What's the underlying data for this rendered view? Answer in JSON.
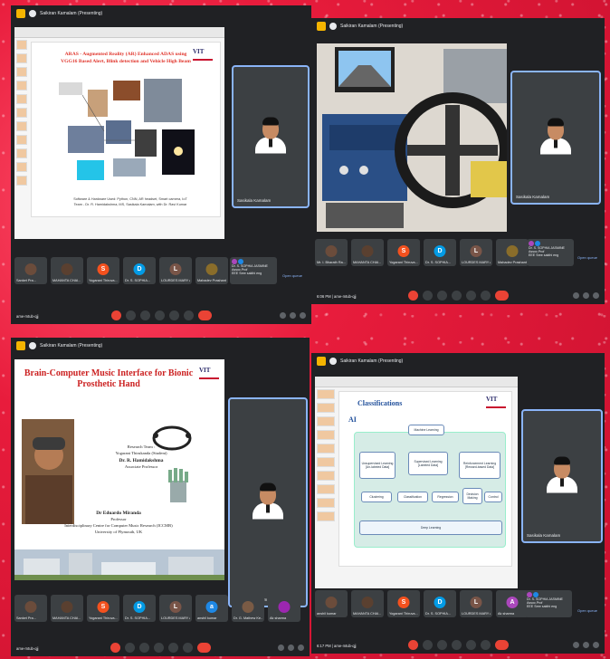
{
  "windows": [
    {
      "title": "Saikiran Kamalam (Presenting)",
      "self_name": "Sasikala Kamalam",
      "meeting_code": "ame-mtub-qjj",
      "slide": {
        "title": "ARAS - Augmented Reality (AR) Enhanced ADAS using VGG16 Based Alert, Blink detection and Vehicle High Beam",
        "caption_line1": "Software & Hardware Used: Python, CNN, AR headset, Smart camera, IoT",
        "caption_line2": "Team - Dr. R. Hamidakshma, MS, Sasikala Kamalam, with Dr. Ravi Kumar"
      },
      "participants": [
        {
          "name": "Sanket Pra...",
          "initial": "",
          "color": "#6b4c3b",
          "photo": true
        },
        {
          "name": "MAHANTA CHAI...",
          "initial": "",
          "color": "#5a4030",
          "photo": true
        },
        {
          "name": "Yogarani Thiruva...",
          "initial": "S",
          "color": "#f4511e",
          "photo": false
        },
        {
          "name": "Dr. S. SOPHIA...",
          "initial": "D",
          "color": "#039be5",
          "photo": false
        },
        {
          "name": "LOURDES MARY A",
          "initial": "L",
          "color": "#795548",
          "photo": false
        },
        {
          "name": "Mahadev Prashant",
          "initial": "",
          "color": "#8a6d2a",
          "photo": true
        }
      ],
      "extra": {
        "line1": "Dr. S. SOPHIA JASMINE Assoc.Prof",
        "line2": "EEE Sree sakthi eng"
      },
      "open_queue": "Open queue"
    },
    {
      "title": "Saikiran Kamalam (Presenting)",
      "self_name": "Sasikala Kamalam",
      "meeting_code": "ame-mtub-qjj",
      "time": "6:06 PM",
      "participants": [
        {
          "name": "Mr. I. Bharath Ra...",
          "initial": "",
          "color": "#6b4c3b",
          "photo": true
        },
        {
          "name": "MAHANTA CHAI...",
          "initial": "",
          "color": "#5a4030",
          "photo": true
        },
        {
          "name": "Yogarani Thiruva...",
          "initial": "S",
          "color": "#f4511e",
          "photo": false
        },
        {
          "name": "Dr. S. SOPHIA...",
          "initial": "D",
          "color": "#039be5",
          "photo": false
        },
        {
          "name": "LOURDES MARY A",
          "initial": "L",
          "color": "#795548",
          "photo": false
        },
        {
          "name": "Mahadev Prashant",
          "initial": "",
          "color": "#8a6d2a",
          "photo": true
        }
      ],
      "extra": {
        "line1": "Dr. S. SOPHIA JASMINE Assoc.Prof",
        "line2": "EEE Sree sakthi eng"
      },
      "open_queue": "Open queue"
    },
    {
      "title": "Saikiran Kamalam (Presenting)",
      "self_name": "Sasikala Kamalam",
      "meeting_code": "ame-mtub-qjj",
      "slide": {
        "title": "Brain-Computer Music Interface for Bionic Prosthetic Hand",
        "team_label": "Research Team :",
        "member1": "Yogarani Thirukanda (Student)",
        "member2": "Dr. R. Hamidakshma",
        "member2_role": "Associate Professor",
        "member3": "Dr Eduardo Miranda",
        "member3_role": "Professor",
        "center": "Interdisciplinary Centre for Computer Music Research (ICCMR)",
        "university": "University of Plymouth, UK",
        "logo": "VIT"
      },
      "participants": [
        {
          "name": "Sanket Pra...",
          "initial": "",
          "color": "#6b4c3b",
          "photo": true
        },
        {
          "name": "MAHANTA CHAI...",
          "initial": "",
          "color": "#5a4030",
          "photo": true
        },
        {
          "name": "Yogarani Thiruva...",
          "initial": "S",
          "color": "#f4511e",
          "photo": false
        },
        {
          "name": "Dr. S. SOPHIA...",
          "initial": "D",
          "color": "#039be5",
          "photo": false
        },
        {
          "name": "LOURDES MARY A",
          "initial": "L",
          "color": "#795548",
          "photo": false
        },
        {
          "name": "anshil kumar",
          "initial": "a",
          "color": "#1e88e5",
          "photo": false
        },
        {
          "name": "Dr. G. Mathew Ke...",
          "initial": "",
          "color": "#7a5b45",
          "photo": true
        },
        {
          "name": "Ak sharma",
          "initial": "",
          "color": "#9c27b0",
          "photo": false
        }
      ]
    },
    {
      "title": "Saikiran Kamalam (Presenting)",
      "self_name": "Sasikala Kamalam",
      "meeting_code": "ame-mtub-qjj",
      "time": "6:17 PM",
      "slide": {
        "title": "Classifications",
        "section": "AI",
        "root": "Machine Learning",
        "b1": "Unsupervised Learning",
        "b1_sub": "[Un-labeled Data]",
        "b2": "Supervised Learning",
        "b2_sub": "[Labeled Data]",
        "b3": "Reinforcement Learning",
        "b3_sub": "[Reward-based Data]",
        "c1": "Clustering",
        "c2": "Classification",
        "c3": "Regression",
        "c4": "Decision Making",
        "c5": "Control",
        "deep": "Deep Learning",
        "logo": "VIT"
      },
      "participants": [
        {
          "name": "anshil kumar",
          "initial": "",
          "color": "#6b4c3b",
          "photo": true
        },
        {
          "name": "MAHANTA CHAI...",
          "initial": "",
          "color": "#5a4030",
          "photo": true
        },
        {
          "name": "Yogarani Thiruva...",
          "initial": "S",
          "color": "#f4511e",
          "photo": false
        },
        {
          "name": "Dr. S. SOPHIA...",
          "initial": "D",
          "color": "#039be5",
          "photo": false
        },
        {
          "name": "LOURDES MARY A",
          "initial": "L",
          "color": "#795548",
          "photo": false
        },
        {
          "name": "Ak sharma",
          "initial": "A",
          "color": "#ab47bc",
          "photo": false
        }
      ],
      "extra": {
        "line1": "Dr. S. SOPHIA JASMINE Assoc.Prof",
        "line2": "EEE Sree sakthi eng"
      },
      "open_queue": "Open queue"
    }
  ]
}
